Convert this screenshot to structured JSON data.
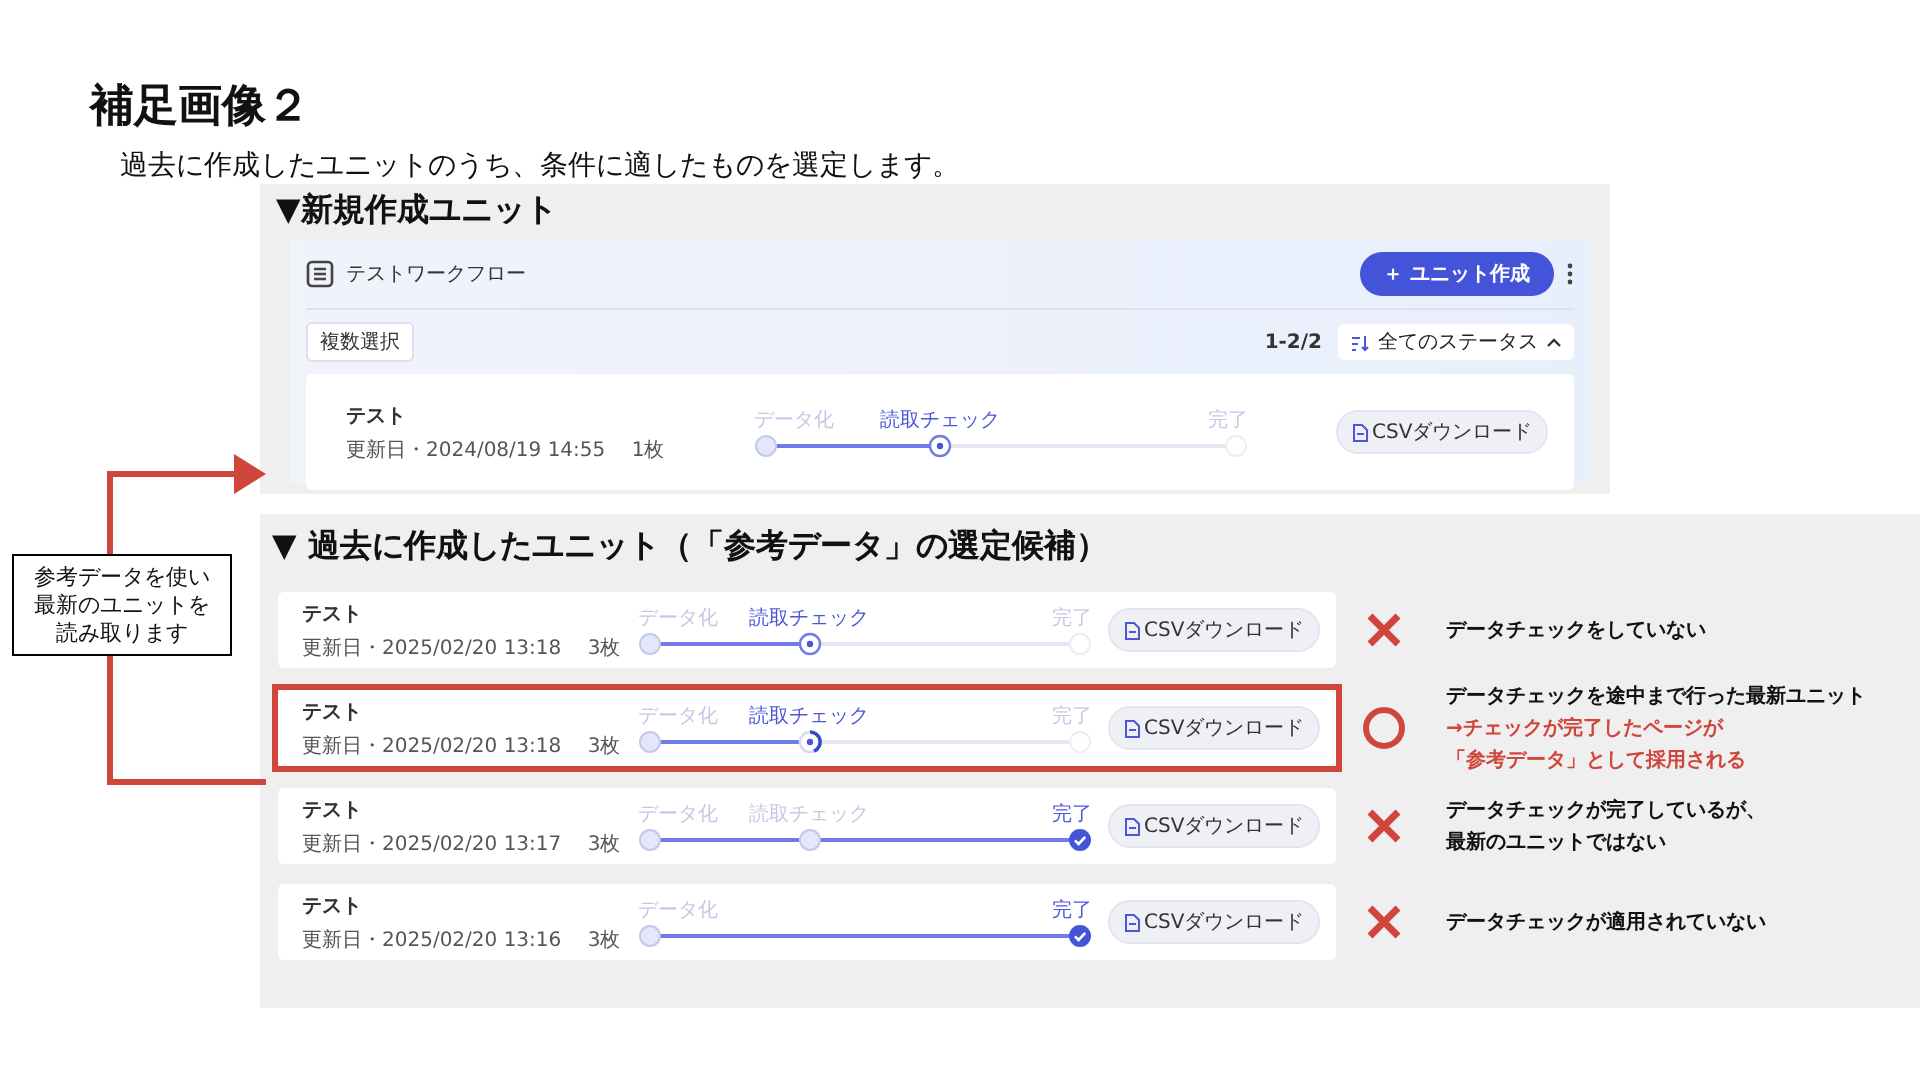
{
  "title": "補足画像２",
  "subtitle": "過去に作成したユニットのうち、条件に適したものを選定します。",
  "note": "参考データを使い最新のユニットを読み取ります",
  "new_section": {
    "heading": "▼新規作成ユニット",
    "app": {
      "workflow_title": "テストワークフロー",
      "create_button": "＋ ユニット作成",
      "multi_select_button": "複数選択",
      "count": "1-2/2",
      "status_filter": "全てのステータス",
      "unit": {
        "name": "テスト",
        "meta": "更新日・2024/08/19 14:55　 1枚",
        "download_button": "CSVダウンロード",
        "steps": [
          {
            "label": "データ化",
            "kind": "done"
          },
          {
            "label": "読取チェック",
            "kind": "current"
          },
          {
            "label": "完了",
            "kind": "pending"
          }
        ]
      }
    }
  },
  "past_section": {
    "heading": "▼ 過去に作成したユニット（「参考データ」の選定候補）",
    "rows": [
      {
        "highlighted": false,
        "unit": {
          "name": "テスト",
          "meta": "更新日・2025/02/20 13:18　 3枚",
          "download_button": "CSVダウンロード",
          "steps": [
            {
              "label": "データ化",
              "kind": "done"
            },
            {
              "label": "読取チェック",
              "kind": "current"
            },
            {
              "label": "完了",
              "kind": "pending"
            }
          ]
        },
        "verdict": {
          "adopted": false,
          "lines": [
            {
              "text": "データチェックをしていない",
              "emphasis": false
            }
          ]
        }
      },
      {
        "highlighted": true,
        "unit": {
          "name": "テスト",
          "meta": "更新日・2025/02/20 13:18　 3枚",
          "download_button": "CSVダウンロード",
          "steps": [
            {
              "label": "データ化",
              "kind": "done"
            },
            {
              "label": "読取チェック",
              "kind": "partial"
            },
            {
              "label": "完了",
              "kind": "pending"
            }
          ]
        },
        "verdict": {
          "adopted": true,
          "lines": [
            {
              "text": "データチェックを途中まで行った最新ユニット",
              "emphasis": false
            },
            {
              "text": "→チェックが完了したページが",
              "emphasis": true
            },
            {
              "text": "「参考データ」として採用される",
              "emphasis": true
            }
          ]
        }
      },
      {
        "highlighted": false,
        "unit": {
          "name": "テスト",
          "meta": "更新日・2025/02/20 13:17　 3枚",
          "download_button": "CSVダウンロード",
          "steps": [
            {
              "label": "データ化",
              "kind": "done"
            },
            {
              "label": "読取チェック",
              "kind": "done"
            },
            {
              "label": "完了",
              "kind": "complete"
            }
          ]
        },
        "verdict": {
          "adopted": false,
          "lines": [
            {
              "text": "データチェックが完了しているが、",
              "emphasis": false
            },
            {
              "text": "最新のユニットではない",
              "emphasis": false
            }
          ]
        }
      },
      {
        "highlighted": false,
        "unit": {
          "name": "テスト",
          "meta": "更新日・2025/02/20 13:16　 3枚",
          "download_button": "CSVダウンロード",
          "steps": [
            {
              "label": "データ化",
              "kind": "done"
            },
            {
              "label": "完了",
              "kind": "complete"
            }
          ]
        },
        "verdict": {
          "adopted": false,
          "lines": [
            {
              "text": "データチェックが適用されていない",
              "emphasis": false
            }
          ]
        }
      }
    ]
  }
}
